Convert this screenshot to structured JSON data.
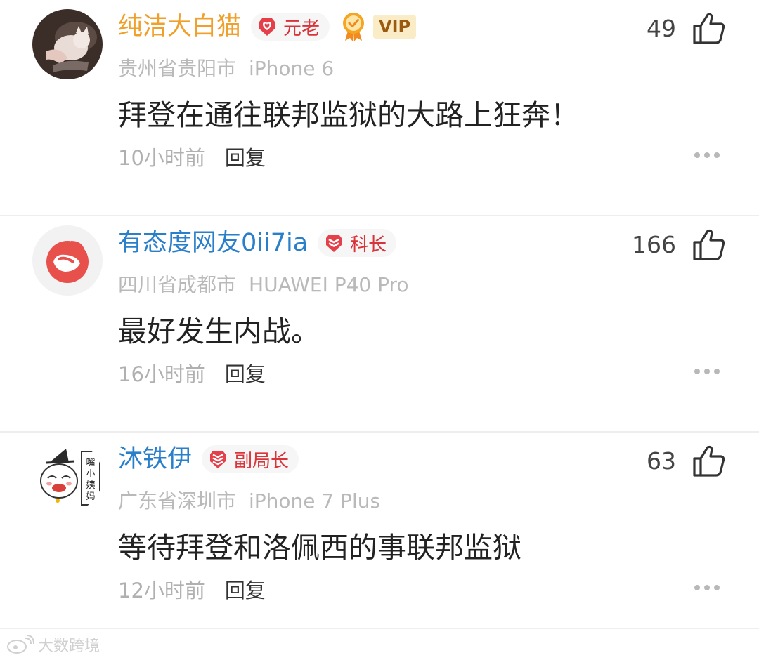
{
  "comments": [
    {
      "username": "纯洁大白猫",
      "badge": "元老",
      "vip": "VIP",
      "location": "贵州省贵阳市",
      "device": "iPhone 6",
      "text": "拜登在通往联邦监狱的大路上狂奔！",
      "time": "10小时前",
      "reply": "回复",
      "likes": "49"
    },
    {
      "username": "有态度网友0ii7ia",
      "badge": "科长",
      "location": "四川省成都市",
      "device": "HUAWEI P40 Pro",
      "text": "最好发生内战。",
      "time": "16小时前",
      "reply": "回复",
      "likes": "166"
    },
    {
      "username": "沐铁伊",
      "badge": "副局长",
      "avatar_text": "嘴小姨妈",
      "location": "广东省深圳市",
      "device": "iPhone 7 Plus",
      "text": "等待拜登和洛佩西的事联邦监狱",
      "time": "12小时前",
      "reply": "回复",
      "likes": "63"
    }
  ],
  "watermark": "大数跨境",
  "colors": {
    "username_orange": "#f0a02a",
    "username_blue": "#2a7fcb",
    "badge_red": "#d8343a",
    "meta_gray": "#b9b9b9"
  },
  "icons": [
    "thumbs-up-icon",
    "more-dots-icon",
    "heart-badge-icon",
    "rank-badge-icon",
    "medal-icon",
    "weibo-logo-icon"
  ]
}
